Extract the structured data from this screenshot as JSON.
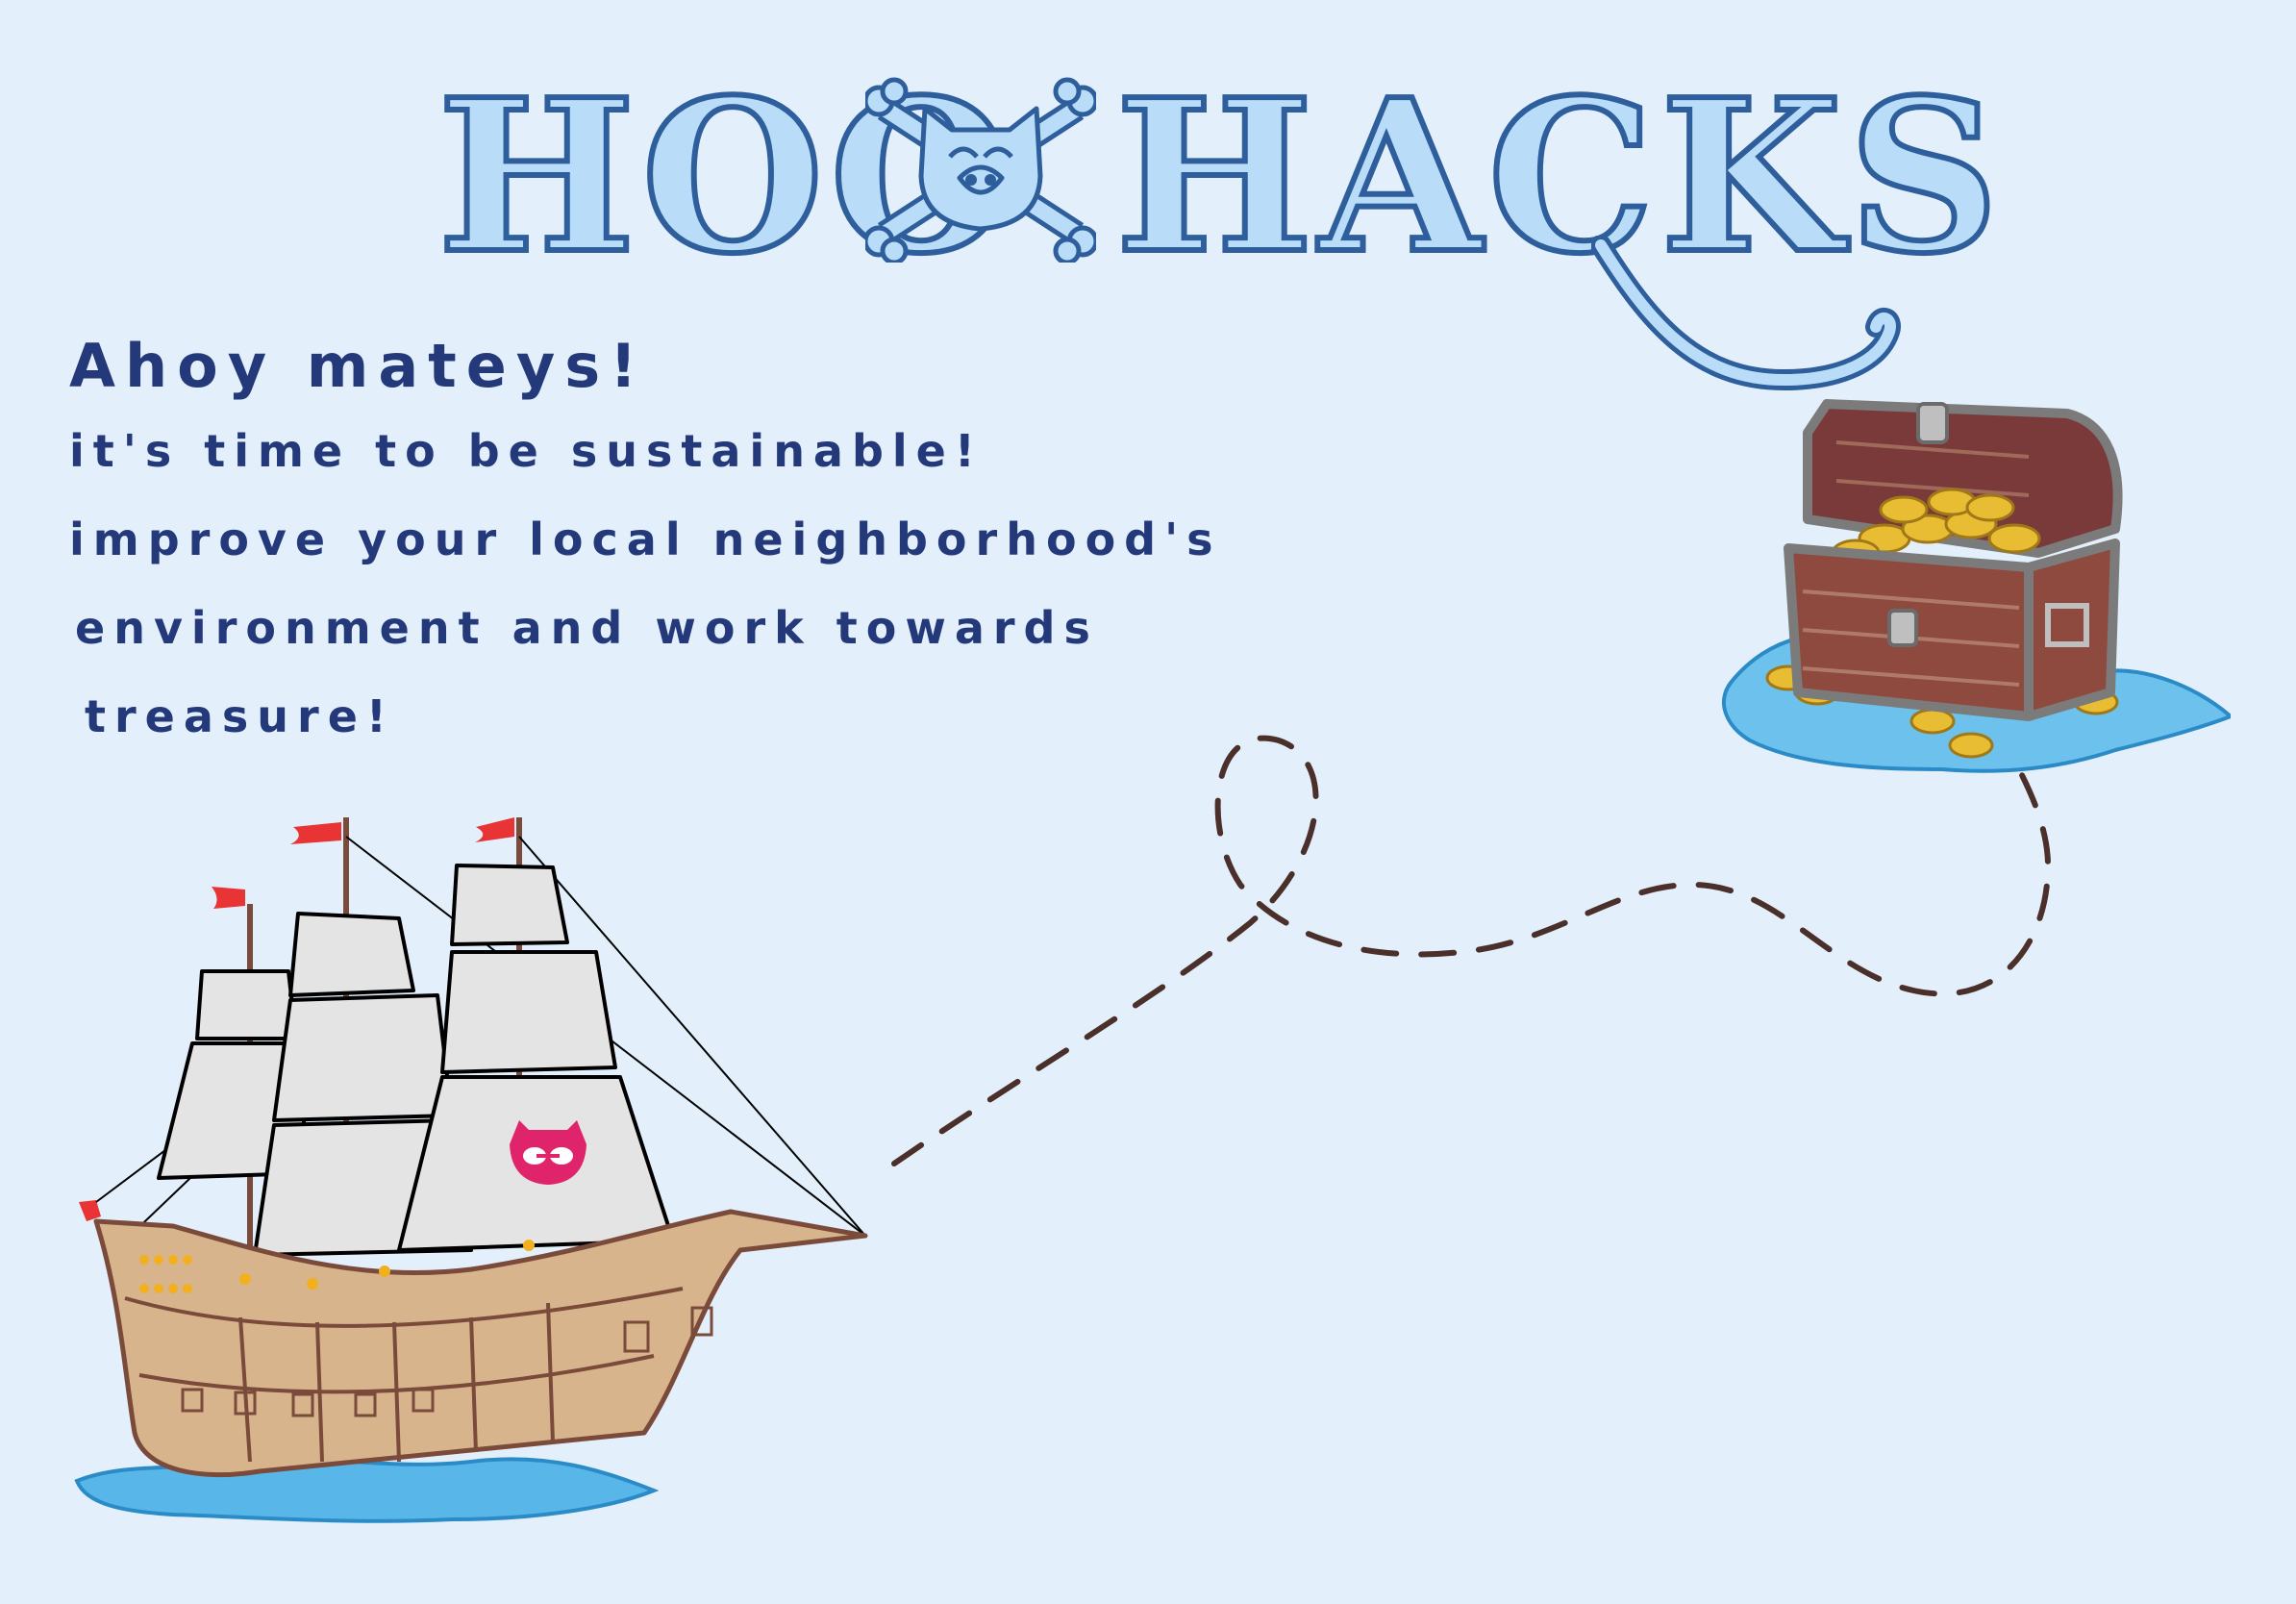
{
  "title": {
    "left": "HOO",
    "right": "HACKS",
    "emblem_icon": "owl-crossbones-icon"
  },
  "message": {
    "greeting": "Ahoy mateys!",
    "lines": [
      "it's time to be sustainable!",
      "improve your local neighborhood's",
      "environment and work towards",
      "treasure!"
    ]
  },
  "illustrations": {
    "ship_icon": "pirate-ship-icon",
    "ship_emblem_icon": "owl-emblem-icon",
    "chest_icon": "treasure-chest-icon",
    "path_icon": "dashed-trail-icon"
  },
  "colors": {
    "background": "#e3f0fc",
    "title_fill": "#b9dcf8",
    "title_outline": "#2e5f9c",
    "text": "#24397a",
    "trail": "#4a2f2a",
    "sail_emblem": "#e0246b"
  }
}
